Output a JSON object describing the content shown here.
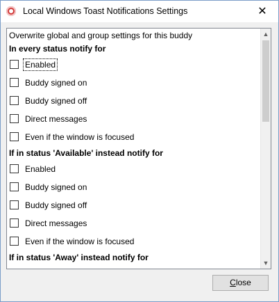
{
  "window": {
    "title": "Local Windows Toast Notifications Settings",
    "close_glyph": "✕"
  },
  "settings": {
    "header": "Overwrite global and group settings for this buddy",
    "sections": [
      {
        "heading": "In every status notify for",
        "options": [
          {
            "label": "Enabled",
            "checked": false,
            "focused": true
          },
          {
            "label": "Buddy signed on",
            "checked": false
          },
          {
            "label": "Buddy signed off",
            "checked": false
          },
          {
            "label": "Direct messages",
            "checked": false
          },
          {
            "label": "Even if the window is focused",
            "checked": false
          }
        ]
      },
      {
        "heading": "If in status 'Available' instead notify for",
        "options": [
          {
            "label": "Enabled",
            "checked": false
          },
          {
            "label": "Buddy signed on",
            "checked": false
          },
          {
            "label": "Buddy signed off",
            "checked": false
          },
          {
            "label": "Direct messages",
            "checked": false
          },
          {
            "label": "Even if the window is focused",
            "checked": false
          }
        ]
      },
      {
        "heading": "If in status 'Away' instead notify for",
        "options": []
      }
    ]
  },
  "scrollbar": {
    "up_glyph": "▲",
    "down_glyph": "▼"
  },
  "buttons": {
    "close_first": "C",
    "close_rest": "lose"
  },
  "icons": {
    "app": "pidgin-app-icon",
    "close": "close-icon"
  }
}
